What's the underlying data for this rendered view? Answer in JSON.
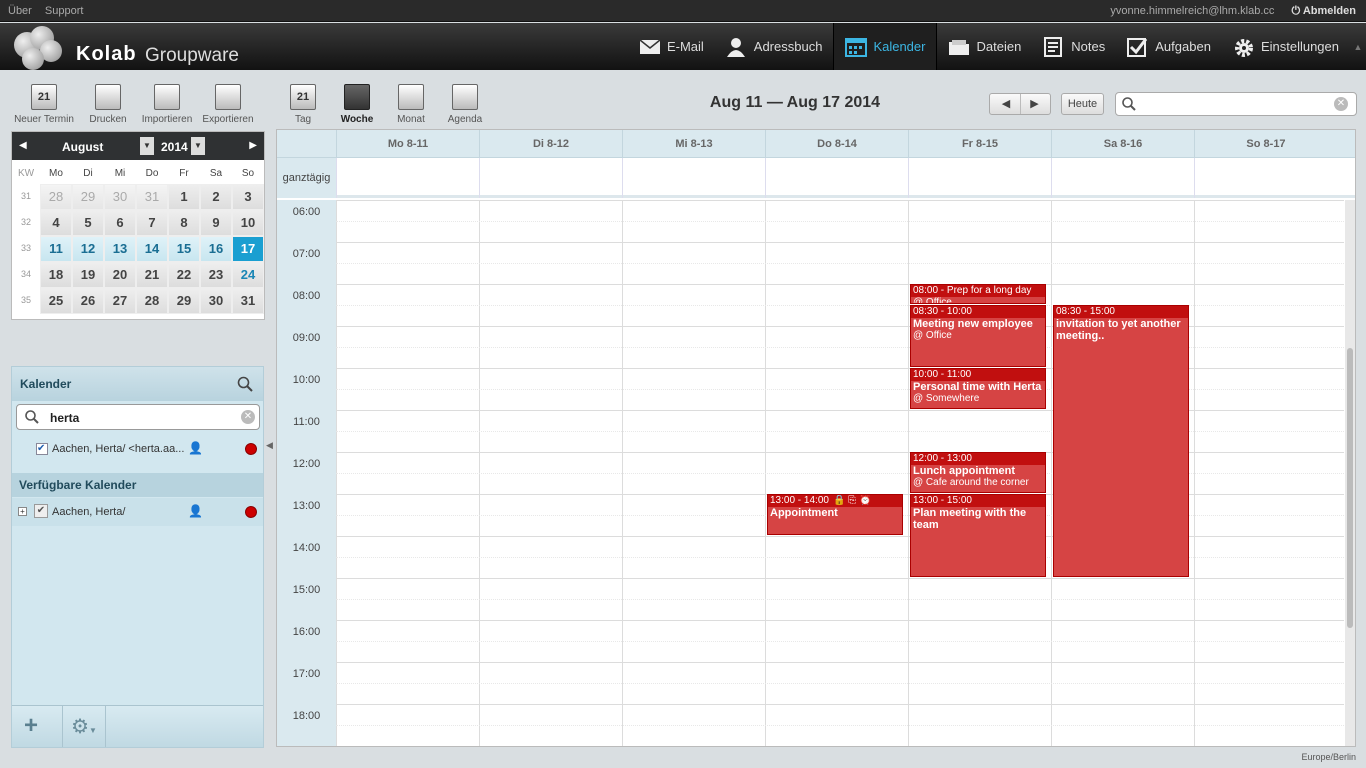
{
  "topline": {
    "about": "Über",
    "support": "Support",
    "user": "yvonne.himmelreich@lhm.klab.cc",
    "logout": "Abmelden"
  },
  "brand": {
    "name": "Kolab",
    "product": "Groupware"
  },
  "nav": [
    {
      "label": "E-Mail",
      "icon": "mail-icon"
    },
    {
      "label": "Adressbuch",
      "icon": "addressbook-icon"
    },
    {
      "label": "Kalender",
      "icon": "calendar-icon"
    },
    {
      "label": "Dateien",
      "icon": "files-icon"
    },
    {
      "label": "Notes",
      "icon": "notes-icon"
    },
    {
      "label": "Aufgaben",
      "icon": "tasks-icon"
    },
    {
      "label": "Einstellungen",
      "icon": "settings-icon"
    }
  ],
  "toolbar": {
    "new": "Neuer Termin",
    "print": "Drucken",
    "import": "Importieren",
    "export": "Exportieren",
    "day": "Tag",
    "week": "Woche",
    "month": "Monat",
    "agenda": "Agenda",
    "day_icon_number": "21",
    "new_icon_number": "21"
  },
  "daterange": "Aug 11 — Aug 17 2014",
  "today_button": "Heute",
  "minical": {
    "month": "August",
    "year": "2014",
    "header": [
      "KW",
      "Mo",
      "Di",
      "Mi",
      "Do",
      "Fr",
      "Sa",
      "So"
    ],
    "weeks": [
      {
        "kw": "31",
        "days": [
          "28",
          "29",
          "30",
          "31",
          "1",
          "2",
          "3"
        ]
      },
      {
        "kw": "32",
        "days": [
          "4",
          "5",
          "6",
          "7",
          "8",
          "9",
          "10"
        ]
      },
      {
        "kw": "33",
        "days": [
          "11",
          "12",
          "13",
          "14",
          "15",
          "16",
          "17"
        ]
      },
      {
        "kw": "34",
        "days": [
          "18",
          "19",
          "20",
          "21",
          "22",
          "23",
          "24"
        ]
      },
      {
        "kw": "35",
        "days": [
          "25",
          "26",
          "27",
          "28",
          "29",
          "30",
          "31"
        ]
      }
    ]
  },
  "calendars": {
    "title": "Kalender",
    "search_value": "herta",
    "result": "Aachen, Herta/ <herta.aa...",
    "available_title": "Verfügbare Kalender",
    "available_item": "Aachen, Herta/",
    "color": "#cc0000"
  },
  "week": {
    "days": [
      "Mo 8-11",
      "Di 8-12",
      "Mi 8-13",
      "Do 8-14",
      "Fr 8-15",
      "Sa 8-16",
      "So 8-17"
    ],
    "allday_label": "ganztägig",
    "hours": [
      "06:00",
      "07:00",
      "08:00",
      "09:00",
      "10:00",
      "11:00",
      "12:00",
      "13:00",
      "14:00",
      "15:00",
      "16:00",
      "17:00",
      "18:00"
    ]
  },
  "events": [
    {
      "day": 4,
      "time": "08:00 - Prep for a long day",
      "title": "",
      "location": "@ Office",
      "start": 8.0,
      "end": 8.5
    },
    {
      "day": 4,
      "time": "08:30 - 10:00",
      "title": "Meeting new employee",
      "location": "@ Office",
      "start": 8.5,
      "end": 10.0
    },
    {
      "day": 4,
      "time": "10:00 - 11:00",
      "title": "Personal time with Herta",
      "location": "@ Somewhere",
      "start": 10.0,
      "end": 11.0
    },
    {
      "day": 4,
      "time": "12:00 - 13:00",
      "title": "Lunch appointment",
      "location": "@ Cafe around the corner",
      "start": 12.0,
      "end": 13.0
    },
    {
      "day": 4,
      "time": "13:00 - 15:00",
      "title": "Plan meeting with the team",
      "location": "",
      "start": 13.0,
      "end": 15.0
    },
    {
      "day": 5,
      "time": "08:30 - 15:00",
      "title": "invitation to yet another meeting..",
      "location": "",
      "start": 8.5,
      "end": 15.0
    },
    {
      "day": 3,
      "time": "13:00 - 14:00",
      "title": "Appointment",
      "location": "",
      "start": 13.0,
      "end": 14.0,
      "icons": "🔒 ⎘ ⏰"
    }
  ],
  "timezone": "Europe/Berlin"
}
